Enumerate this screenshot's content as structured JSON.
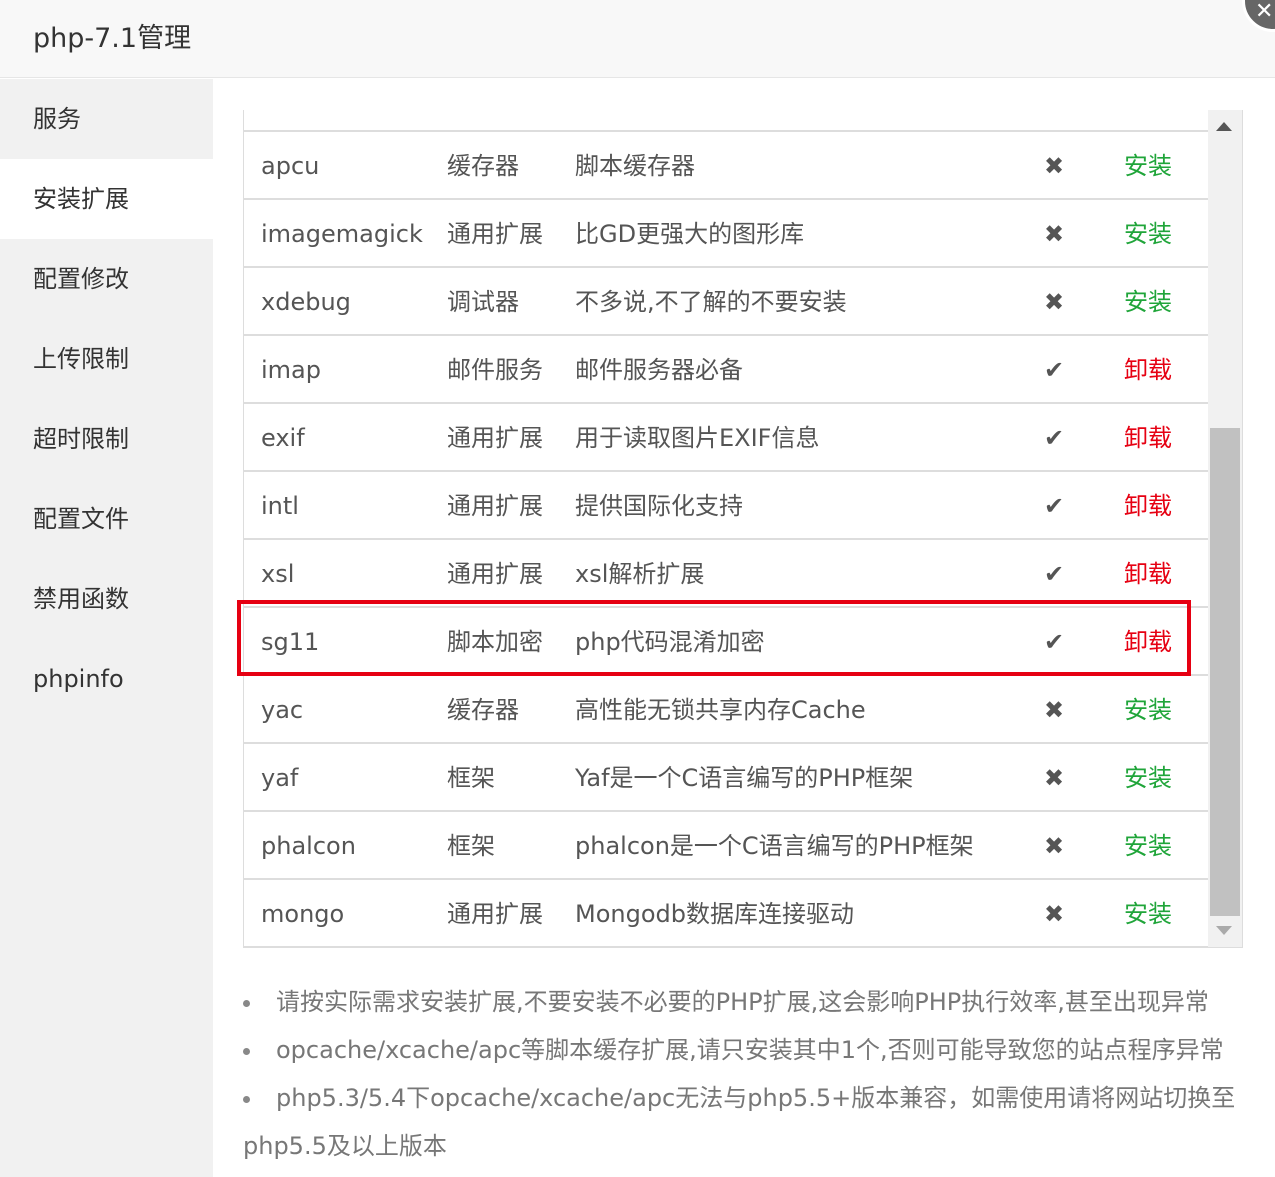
{
  "window": {
    "title": "php-7.1管理",
    "close_icon": "close-icon"
  },
  "sidebar": {
    "items": [
      {
        "label": "服务",
        "active": false
      },
      {
        "label": "安装扩展",
        "active": true
      },
      {
        "label": "配置修改",
        "active": false
      },
      {
        "label": "上传限制",
        "active": false
      },
      {
        "label": "超时限制",
        "active": false
      },
      {
        "label": "配置文件",
        "active": false
      },
      {
        "label": "禁用函数",
        "active": false
      },
      {
        "label": "phpinfo",
        "active": false
      }
    ]
  },
  "extensions": {
    "rows": [
      {
        "name": "apcu",
        "type": "缓存器",
        "desc": "脚本缓存器",
        "status": "✖",
        "installed": false,
        "action": "安装"
      },
      {
        "name": "imagemagick",
        "type": "通用扩展",
        "desc": "比GD更强大的图形库",
        "status": "✖",
        "installed": false,
        "action": "安装"
      },
      {
        "name": "xdebug",
        "type": "调试器",
        "desc": "不多说,不了解的不要安装",
        "status": "✖",
        "installed": false,
        "action": "安装"
      },
      {
        "name": "imap",
        "type": "邮件服务",
        "desc": "邮件服务器必备",
        "status": "✔",
        "installed": true,
        "action": "卸载"
      },
      {
        "name": "exif",
        "type": "通用扩展",
        "desc": "用于读取图片EXIF信息",
        "status": "✔",
        "installed": true,
        "action": "卸载"
      },
      {
        "name": "intl",
        "type": "通用扩展",
        "desc": "提供国际化支持",
        "status": "✔",
        "installed": true,
        "action": "卸载"
      },
      {
        "name": "xsl",
        "type": "通用扩展",
        "desc": "xsl解析扩展",
        "status": "✔",
        "installed": true,
        "action": "卸载"
      },
      {
        "name": "sg11",
        "type": "脚本加密",
        "desc": "php代码混淆加密",
        "status": "✔",
        "installed": true,
        "action": "卸载"
      },
      {
        "name": "yac",
        "type": "缓存器",
        "desc": "高性能无锁共享内存Cache",
        "status": "✖",
        "installed": false,
        "action": "安装"
      },
      {
        "name": "yaf",
        "type": "框架",
        "desc": "Yaf是一个C语言编写的PHP框架",
        "status": "✖",
        "installed": false,
        "action": "安装"
      },
      {
        "name": "phalcon",
        "type": "框架",
        "desc": "phalcon是一个C语言编写的PHP框架",
        "status": "✖",
        "installed": false,
        "action": "安装"
      },
      {
        "name": "mongo",
        "type": "通用扩展",
        "desc": "Mongodb数据库连接驱动",
        "status": "✖",
        "installed": false,
        "action": "安装"
      }
    ],
    "highlighted_row": "sg11"
  },
  "notes": [
    "请按实际需求安装扩展,不要安装不必要的PHP扩展,这会影响PHP执行效率,甚至出现异常",
    "opcache/xcache/apc等脚本缓存扩展,请只安装其中1个,否则可能导致您的站点程序异常",
    "php5.3/5.4下opcache/xcache/apc无法与php5.5+版本兼容，如需使用请将网站切换至",
    "php5.5及以上版本"
  ],
  "colors": {
    "install": "#20a53a",
    "uninstall": "#e60012",
    "highlight": "#e60012"
  }
}
